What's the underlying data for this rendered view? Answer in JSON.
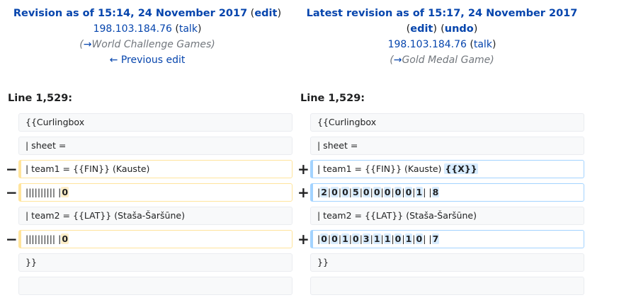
{
  "left_header": {
    "title": "Revision as of 15:14, 24 November 2017",
    "edit": "edit",
    "user": "198.103.184.76",
    "talk": "talk",
    "summary_arrow": "→",
    "summary": "World Challenge Games",
    "prev_edit": "← Previous edit"
  },
  "right_header": {
    "title": "Latest revision as of 15:17, 24 November 2017",
    "edit": "edit",
    "undo": "undo",
    "user": "198.103.184.76",
    "talk": "talk",
    "summary_arrow": "→",
    "summary": "Gold Medal Game"
  },
  "left_line": "Line 1,529:",
  "right_line": "Line 1,529:",
  "markers": {
    "minus": "−",
    "plus": "+"
  },
  "rows": {
    "r1": {
      "left": "{{Curlingbox",
      "right": "{{Curlingbox"
    },
    "r2": {
      "left": "| sheet =",
      "right": "| sheet ="
    },
    "r3": {
      "left": "| team1 = {{FIN}} (Kauste)",
      "right": "| team1 = {{FIN}} (Kauste)",
      "right_add": "{{X}}"
    },
    "r4": {
      "left_pre": "|||||||||| |",
      "left_del": "0",
      "right": [
        {
          "t": "|"
        },
        {
          "t": "2",
          "h": 1
        },
        {
          "t": "|"
        },
        {
          "t": "0",
          "h": 1
        },
        {
          "t": "|"
        },
        {
          "t": "0",
          "h": 1
        },
        {
          "t": "|"
        },
        {
          "t": "5",
          "h": 1
        },
        {
          "t": "|"
        },
        {
          "t": "0",
          "h": 1
        },
        {
          "t": "|"
        },
        {
          "t": "0",
          "h": 1
        },
        {
          "t": "|"
        },
        {
          "t": "0",
          "h": 1
        },
        {
          "t": "|"
        },
        {
          "t": "0",
          "h": 1
        },
        {
          "t": "|"
        },
        {
          "t": "0",
          "h": 1
        },
        {
          "t": "|"
        },
        {
          "t": "1",
          "h": 1
        },
        {
          "t": "| |"
        },
        {
          "t": "8",
          "h": 1
        }
      ]
    },
    "r5": {
      "left": "| team2 = {{LAT}} (Staša-Šaršūne)",
      "right": "| team2 = {{LAT}} (Staša-Šaršūne)"
    },
    "r6": {
      "left_pre": "|||||||||| |",
      "left_del": "0",
      "right": [
        {
          "t": "|"
        },
        {
          "t": "0",
          "h": 1
        },
        {
          "t": "|"
        },
        {
          "t": "0",
          "h": 1
        },
        {
          "t": "|"
        },
        {
          "t": "1",
          "h": 1
        },
        {
          "t": "|"
        },
        {
          "t": "0",
          "h": 1
        },
        {
          "t": "|"
        },
        {
          "t": "3",
          "h": 1
        },
        {
          "t": "|"
        },
        {
          "t": "1",
          "h": 1
        },
        {
          "t": "|"
        },
        {
          "t": "1",
          "h": 1
        },
        {
          "t": "|"
        },
        {
          "t": "0",
          "h": 1
        },
        {
          "t": "|"
        },
        {
          "t": "1",
          "h": 1
        },
        {
          "t": "|"
        },
        {
          "t": "0",
          "h": 1
        },
        {
          "t": "| |"
        },
        {
          "t": "7",
          "h": 1
        }
      ]
    },
    "r7": {
      "left": "}}",
      "right": "}}"
    },
    "r8": {
      "left": "",
      "right": ""
    }
  }
}
